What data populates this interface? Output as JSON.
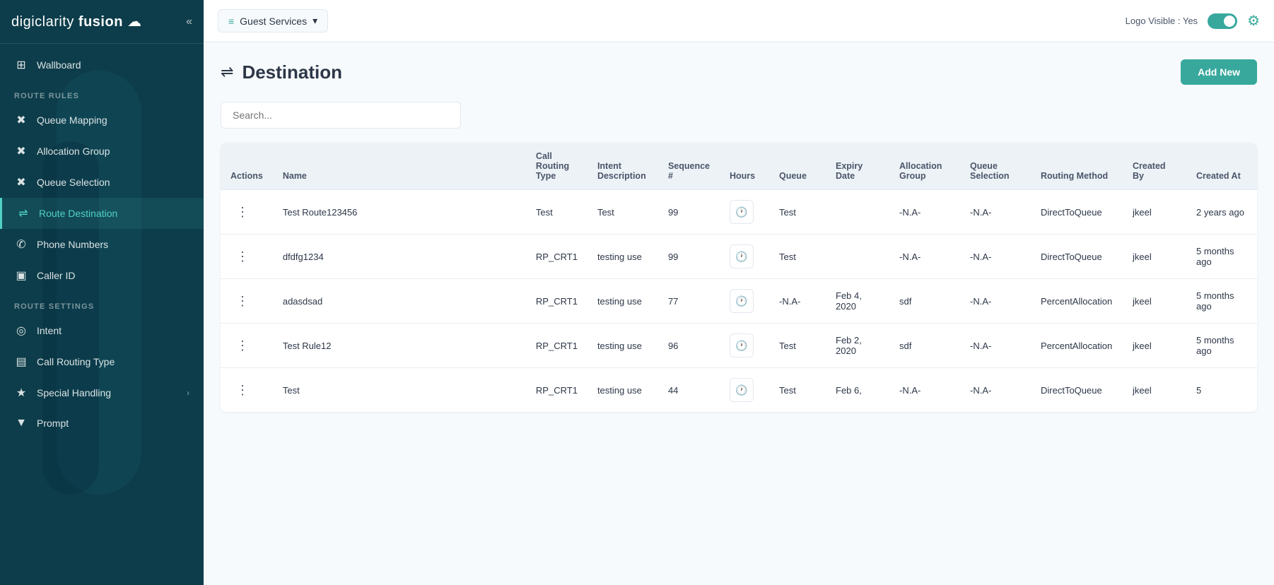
{
  "app": {
    "title": "digiclarity fusion",
    "collapse_icon": "«"
  },
  "topbar": {
    "breadcrumb_icon": "≡",
    "breadcrumb_label": "Guest Services",
    "breadcrumb_arrow": "▾",
    "logo_visible_label": "Logo Visible : Yes",
    "add_new_label": "Add New"
  },
  "sidebar": {
    "wallboard_label": "Wallboard",
    "route_rules_section": "ROUTE RULES",
    "queue_mapping_label": "Queue Mapping",
    "allocation_group_label": "Allocation Group",
    "queue_selection_label": "Queue Selection",
    "route_destination_label": "Route Destination",
    "phone_numbers_label": "Phone Numbers",
    "caller_id_label": "Caller ID",
    "route_settings_section": "ROUTE SETTINGS",
    "intent_label": "Intent",
    "call_routing_type_label": "Call Routing Type",
    "special_handling_label": "Special Handling",
    "prompt_label": "Prompt"
  },
  "page": {
    "title": "Destination",
    "title_icon": "⇌",
    "search_placeholder": "Search..."
  },
  "table": {
    "headers": {
      "actions": "Actions",
      "name": "Name",
      "call_routing_type": "Call Routing Type",
      "intent_description": "Intent Description",
      "sequence": "Sequence #",
      "hours": "Hours",
      "queue": "Queue",
      "expiry_date": "Expiry Date",
      "allocation_group": "Allocation Group",
      "queue_selection": "Queue Selection",
      "routing_method": "Routing Method",
      "created_by": "Created By",
      "created_at": "Created At"
    },
    "rows": [
      {
        "name": "Test Route123456",
        "call_routing_type": "Test",
        "intent_description": "Test",
        "sequence": "99",
        "queue": "Test",
        "expiry_date": "",
        "allocation_group": "-N.A-",
        "queue_selection": "-N.A-",
        "routing_method": "DirectToQueue",
        "created_by": "jkeel",
        "created_at": "2 years ago"
      },
      {
        "name": "dfdfg1234",
        "call_routing_type": "RP_CRT1",
        "intent_description": "testing use",
        "sequence": "99",
        "queue": "Test",
        "expiry_date": "",
        "allocation_group": "-N.A-",
        "queue_selection": "-N.A-",
        "routing_method": "DirectToQueue",
        "created_by": "jkeel",
        "created_at": "5 months ago"
      },
      {
        "name": "adasdsad",
        "call_routing_type": "RP_CRT1",
        "intent_description": "testing use",
        "sequence": "77",
        "queue": "-N.A-",
        "expiry_date": "Feb 4, 2020",
        "allocation_group": "sdf",
        "queue_selection": "-N.A-",
        "routing_method": "PercentAllocation",
        "created_by": "jkeel",
        "created_at": "5 months ago"
      },
      {
        "name": "Test Rule12",
        "call_routing_type": "RP_CRT1",
        "intent_description": "testing use",
        "sequence": "96",
        "queue": "Test",
        "expiry_date": "Feb 2, 2020",
        "allocation_group": "sdf",
        "queue_selection": "-N.A-",
        "routing_method": "PercentAllocation",
        "created_by": "jkeel",
        "created_at": "5 months ago"
      },
      {
        "name": "Test",
        "call_routing_type": "RP_CRT1",
        "intent_description": "testing use",
        "sequence": "44",
        "queue": "Test",
        "expiry_date": "Feb 6,",
        "allocation_group": "-N.A-",
        "queue_selection": "-N.A-",
        "routing_method": "DirectToQueue",
        "created_by": "jkeel",
        "created_at": "5"
      }
    ]
  }
}
